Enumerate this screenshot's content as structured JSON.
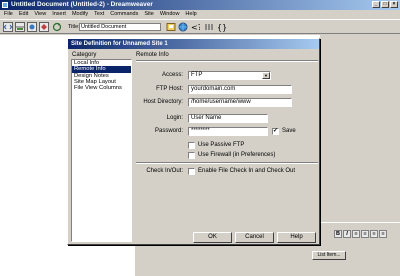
{
  "window": {
    "title": "Untitled Document (Untitled-2) - Dreamweaver"
  },
  "menu": [
    "File",
    "Edit",
    "View",
    "Insert",
    "Modify",
    "Text",
    "Commands",
    "Site",
    "Window",
    "Help"
  ],
  "toolbar": {
    "title_label": "Title:",
    "title_value": "Untitled Document"
  },
  "dialog": {
    "title": "Site Definition for Unnamed Site 1",
    "category_label": "Category",
    "categories": [
      {
        "label": "Local Info",
        "selected": false
      },
      {
        "label": "Remote Info",
        "selected": true
      },
      {
        "label": "Design Notes",
        "selected": false
      },
      {
        "label": "Site Map Layout",
        "selected": false
      },
      {
        "label": "File View Columns",
        "selected": false
      }
    ],
    "section_title": "Remote Info",
    "access": {
      "label": "Access:",
      "value": "FTP"
    },
    "ftp_host": {
      "label": "FTP Host:",
      "value": "yourdomain.com"
    },
    "host_directory": {
      "label": "Host Directory:",
      "value": "/home/username/www"
    },
    "login": {
      "label": "Login:",
      "value": "User Name"
    },
    "password": {
      "label": "Password:",
      "value": "********",
      "save_label": "Save",
      "save_checked": true
    },
    "use_passive_ftp": {
      "label": "Use Passive FTP",
      "checked": false
    },
    "use_firewall": {
      "label": "Use Firewall (in Preferences)",
      "checked": false
    },
    "check_in_out": {
      "label": "Check In/Out:",
      "option_label": "Enable File Check In and Check Out",
      "checked": false
    },
    "buttons": {
      "ok": "OK",
      "cancel": "Cancel",
      "help": "Help"
    }
  },
  "property_panel": {
    "list_item_label": "List Item..."
  }
}
